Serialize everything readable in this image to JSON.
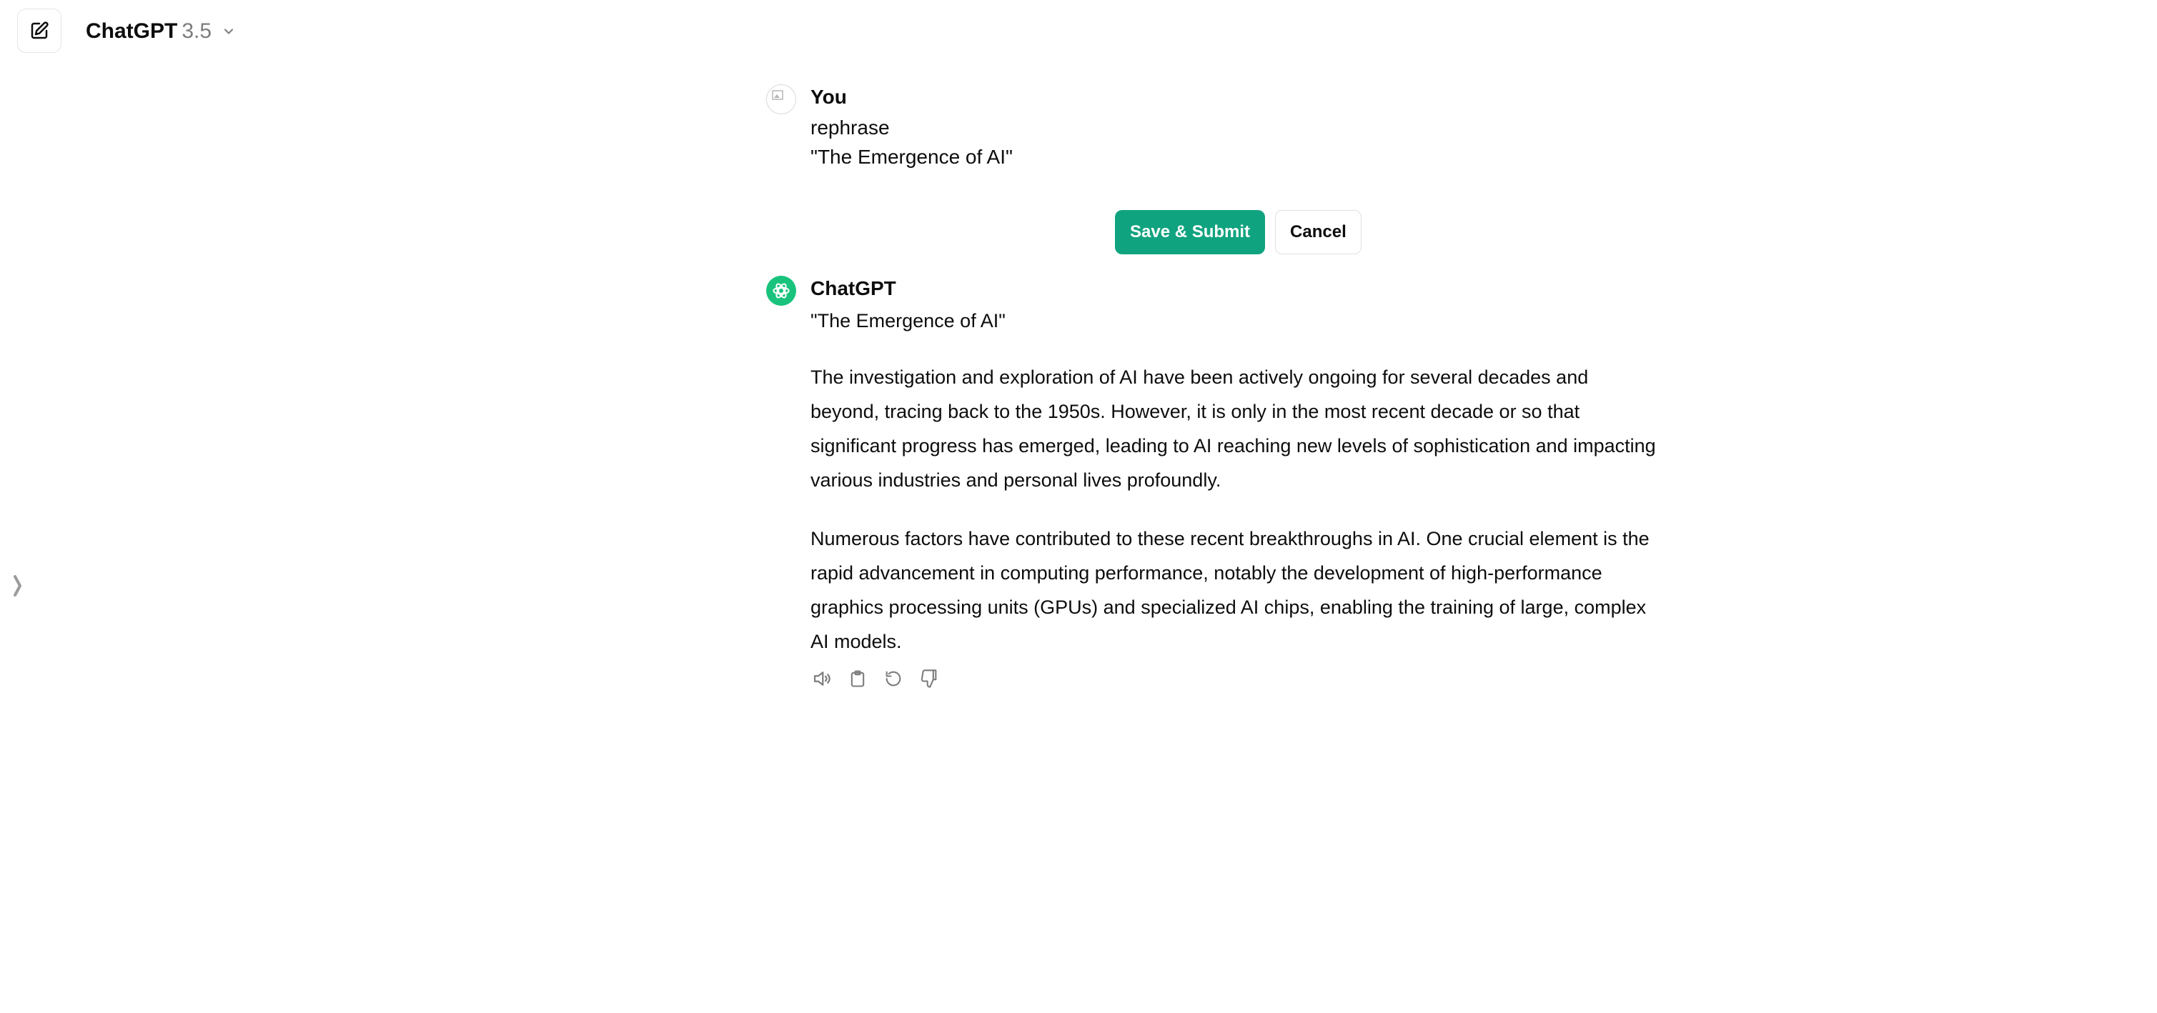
{
  "header": {
    "model_name": "ChatGPT",
    "model_version": "3.5"
  },
  "conversation": {
    "user": {
      "name": "You",
      "edit_text": "rephrase\n\"The Emergence of AI\""
    },
    "edit_buttons": {
      "save_label": "Save & Submit",
      "cancel_label": "Cancel"
    },
    "assistant": {
      "name": "ChatGPT",
      "paragraphs": [
        "\"The Emergence of AI\"",
        "The investigation and exploration of AI have been actively ongoing for several decades and beyond, tracing back to the 1950s. However, it is only in the most recent decade or so that significant progress has emerged, leading to AI reaching new levels of sophistication and impacting various industries and personal lives profoundly.",
        "Numerous factors have contributed to these recent breakthroughs in AI. One crucial element is the rapid advancement in computing performance, notably the development of high-performance graphics processing units (GPUs) and specialized AI chips, enabling the training of large, complex AI models."
      ]
    },
    "actions": [
      "speaker-icon",
      "clipboard-icon",
      "regenerate-icon",
      "thumbs-down-icon"
    ]
  },
  "colors": {
    "accent": "#10a37f",
    "assistant_avatar": "#19c37d",
    "text": "#0d0d0d",
    "muted": "#7d7d7d"
  }
}
